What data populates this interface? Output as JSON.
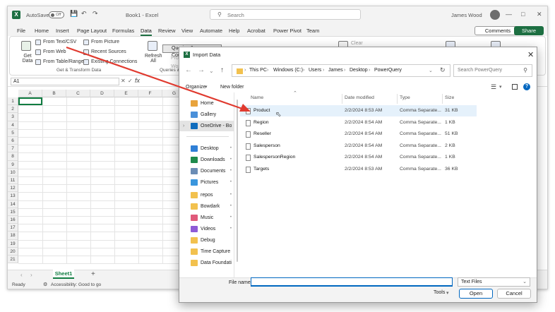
{
  "excel": {
    "autosave_label": "AutoSave",
    "autosave_state": "Off",
    "doc_title": "Book1 - Excel",
    "search_placeholder": "Search",
    "user_name": "James Wood",
    "menu": [
      "File",
      "Home",
      "Insert",
      "Page Layout",
      "Formulas",
      "Data",
      "Review",
      "View",
      "Automate",
      "Help",
      "Acrobat",
      "Power Pivot",
      "Team"
    ],
    "active_menu": "Data",
    "comments_label": "Comments",
    "share_label": "Share",
    "ribbon": {
      "get_data": "Get Data",
      "from_text_csv": "From Text/CSV",
      "from_web": "From Web",
      "from_table_range": "From Table/Range",
      "from_picture": "From Picture",
      "recent_sources": "Recent Sources",
      "existing_connections": "Existing Connections",
      "group_get_transform": "Get & Transform Data",
      "refresh_all": "Refresh All",
      "queries_connections": "Queries & Connections",
      "group_queries": "Queries & C",
      "props_partial": "Prop",
      "wor_partial": "Wor",
      "clear": "Clear"
    },
    "name_box": "A1",
    "columns": [
      "A",
      "B",
      "C",
      "D",
      "E",
      "F",
      "G"
    ],
    "rows": [
      "1",
      "2",
      "3",
      "4",
      "5",
      "6",
      "7",
      "8",
      "9",
      "10",
      "11",
      "12",
      "13",
      "14",
      "15",
      "16",
      "17",
      "18",
      "19",
      "20",
      "21"
    ],
    "sheet_tab": "Sheet1",
    "status_ready": "Ready",
    "accessibility": "Accessibility: Good to go"
  },
  "dialog": {
    "title": "Import Data",
    "breadcrumbs": [
      "This PC",
      "Windows (C:)",
      "Users",
      "James",
      "Desktop",
      "PowerQuery"
    ],
    "search_placeholder": "Search PowerQuery",
    "organize": "Organize",
    "new_folder": "New folder",
    "sidebar": [
      {
        "label": "Home",
        "color": "#e8a33c",
        "pin": false
      },
      {
        "label": "Gallery",
        "color": "#4a90d9",
        "pin": false
      },
      {
        "label": "OneDrive - Bow",
        "color": "#0f6cbd",
        "pin": false
      },
      {
        "label": "Desktop",
        "color": "#2f7fd6",
        "pin": true
      },
      {
        "label": "Downloads",
        "color": "#1f8b4c",
        "pin": true
      },
      {
        "label": "Documents",
        "color": "#6b8db5",
        "pin": true
      },
      {
        "label": "Pictures",
        "color": "#3a96dd",
        "pin": true
      },
      {
        "label": "repos",
        "color": "#f2c14e",
        "pin": true
      },
      {
        "label": "Bowdark",
        "color": "#f2c14e",
        "pin": true
      },
      {
        "label": "Music",
        "color": "#e05a7a",
        "pin": true
      },
      {
        "label": "Videos",
        "color": "#8e5bd6",
        "pin": true
      },
      {
        "label": "Debug",
        "color": "#f2c14e",
        "pin": false
      },
      {
        "label": "Time Capture Pr",
        "color": "#f2c14e",
        "pin": false
      },
      {
        "label": "Data Foundation",
        "color": "#f2c14e",
        "pin": false
      }
    ],
    "columns": {
      "name": "Name",
      "date": "Date modified",
      "type": "Type",
      "size": "Size"
    },
    "files": [
      {
        "name": "Product",
        "date": "2/2/2024 8:53 AM",
        "type": "Comma Separate...",
        "size": "31 KB"
      },
      {
        "name": "Region",
        "date": "2/2/2024 8:54 AM",
        "type": "Comma Separate...",
        "size": "1 KB"
      },
      {
        "name": "Reseller",
        "date": "2/2/2024 8:54 AM",
        "type": "Comma Separate...",
        "size": "51 KB"
      },
      {
        "name": "Salesperson",
        "date": "2/2/2024 8:54 AM",
        "type": "Comma Separate...",
        "size": "2 KB"
      },
      {
        "name": "SalespersonRegion",
        "date": "2/2/2024 8:54 AM",
        "type": "Comma Separate...",
        "size": "1 KB"
      },
      {
        "name": "Targets",
        "date": "2/2/2024 8:53 AM",
        "type": "Comma Separate...",
        "size": "36 KB"
      }
    ],
    "file_name_label": "File name:",
    "file_name_value": "",
    "file_type": "Text Files",
    "tools": "Tools",
    "open": "Open",
    "cancel": "Cancel"
  },
  "colors": {
    "excel_green": "#1d6f42",
    "accent_blue": "#0067c0",
    "arrow_red": "#e03a2f",
    "hover_row": "#e5f1fb"
  }
}
